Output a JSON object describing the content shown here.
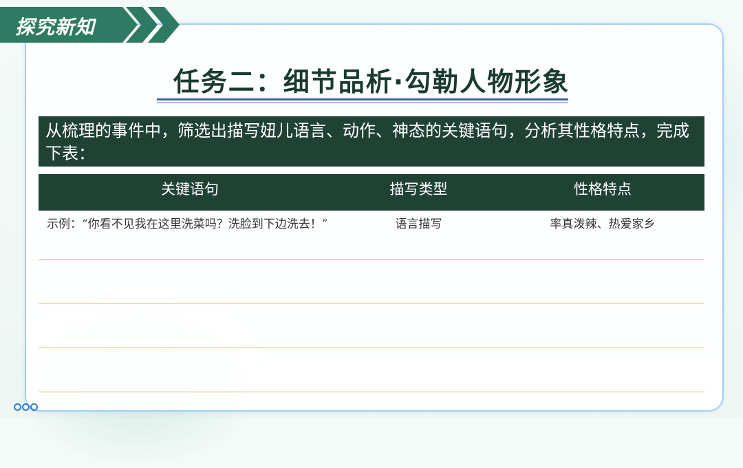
{
  "section_tag": "探究新知",
  "title": "任务二：细节品析·勾勒人物形象",
  "task_text": "从梳理的事件中，筛选出描写妞儿语言、动作、神态的关键语句，分析其性格特点，完成下表：",
  "table": {
    "headers": [
      "关键语句",
      "描写类型",
      "性格特点"
    ],
    "rows": [
      {
        "sentence": "示例：“你看不见我在这里洗菜吗？洗脸到下边洗去！”",
        "type": "语言描写",
        "trait": "率真泼辣、热爱家乡"
      },
      {
        "sentence": "",
        "type": "",
        "trait": ""
      },
      {
        "sentence": "",
        "type": "",
        "trait": ""
      },
      {
        "sentence": "",
        "type": "",
        "trait": ""
      }
    ]
  },
  "colors": {
    "dark_green": "#1f4235",
    "tag_green": "#2e7a62",
    "border_blue": "#a9cdf0",
    "row_line": "#e6b85c"
  }
}
